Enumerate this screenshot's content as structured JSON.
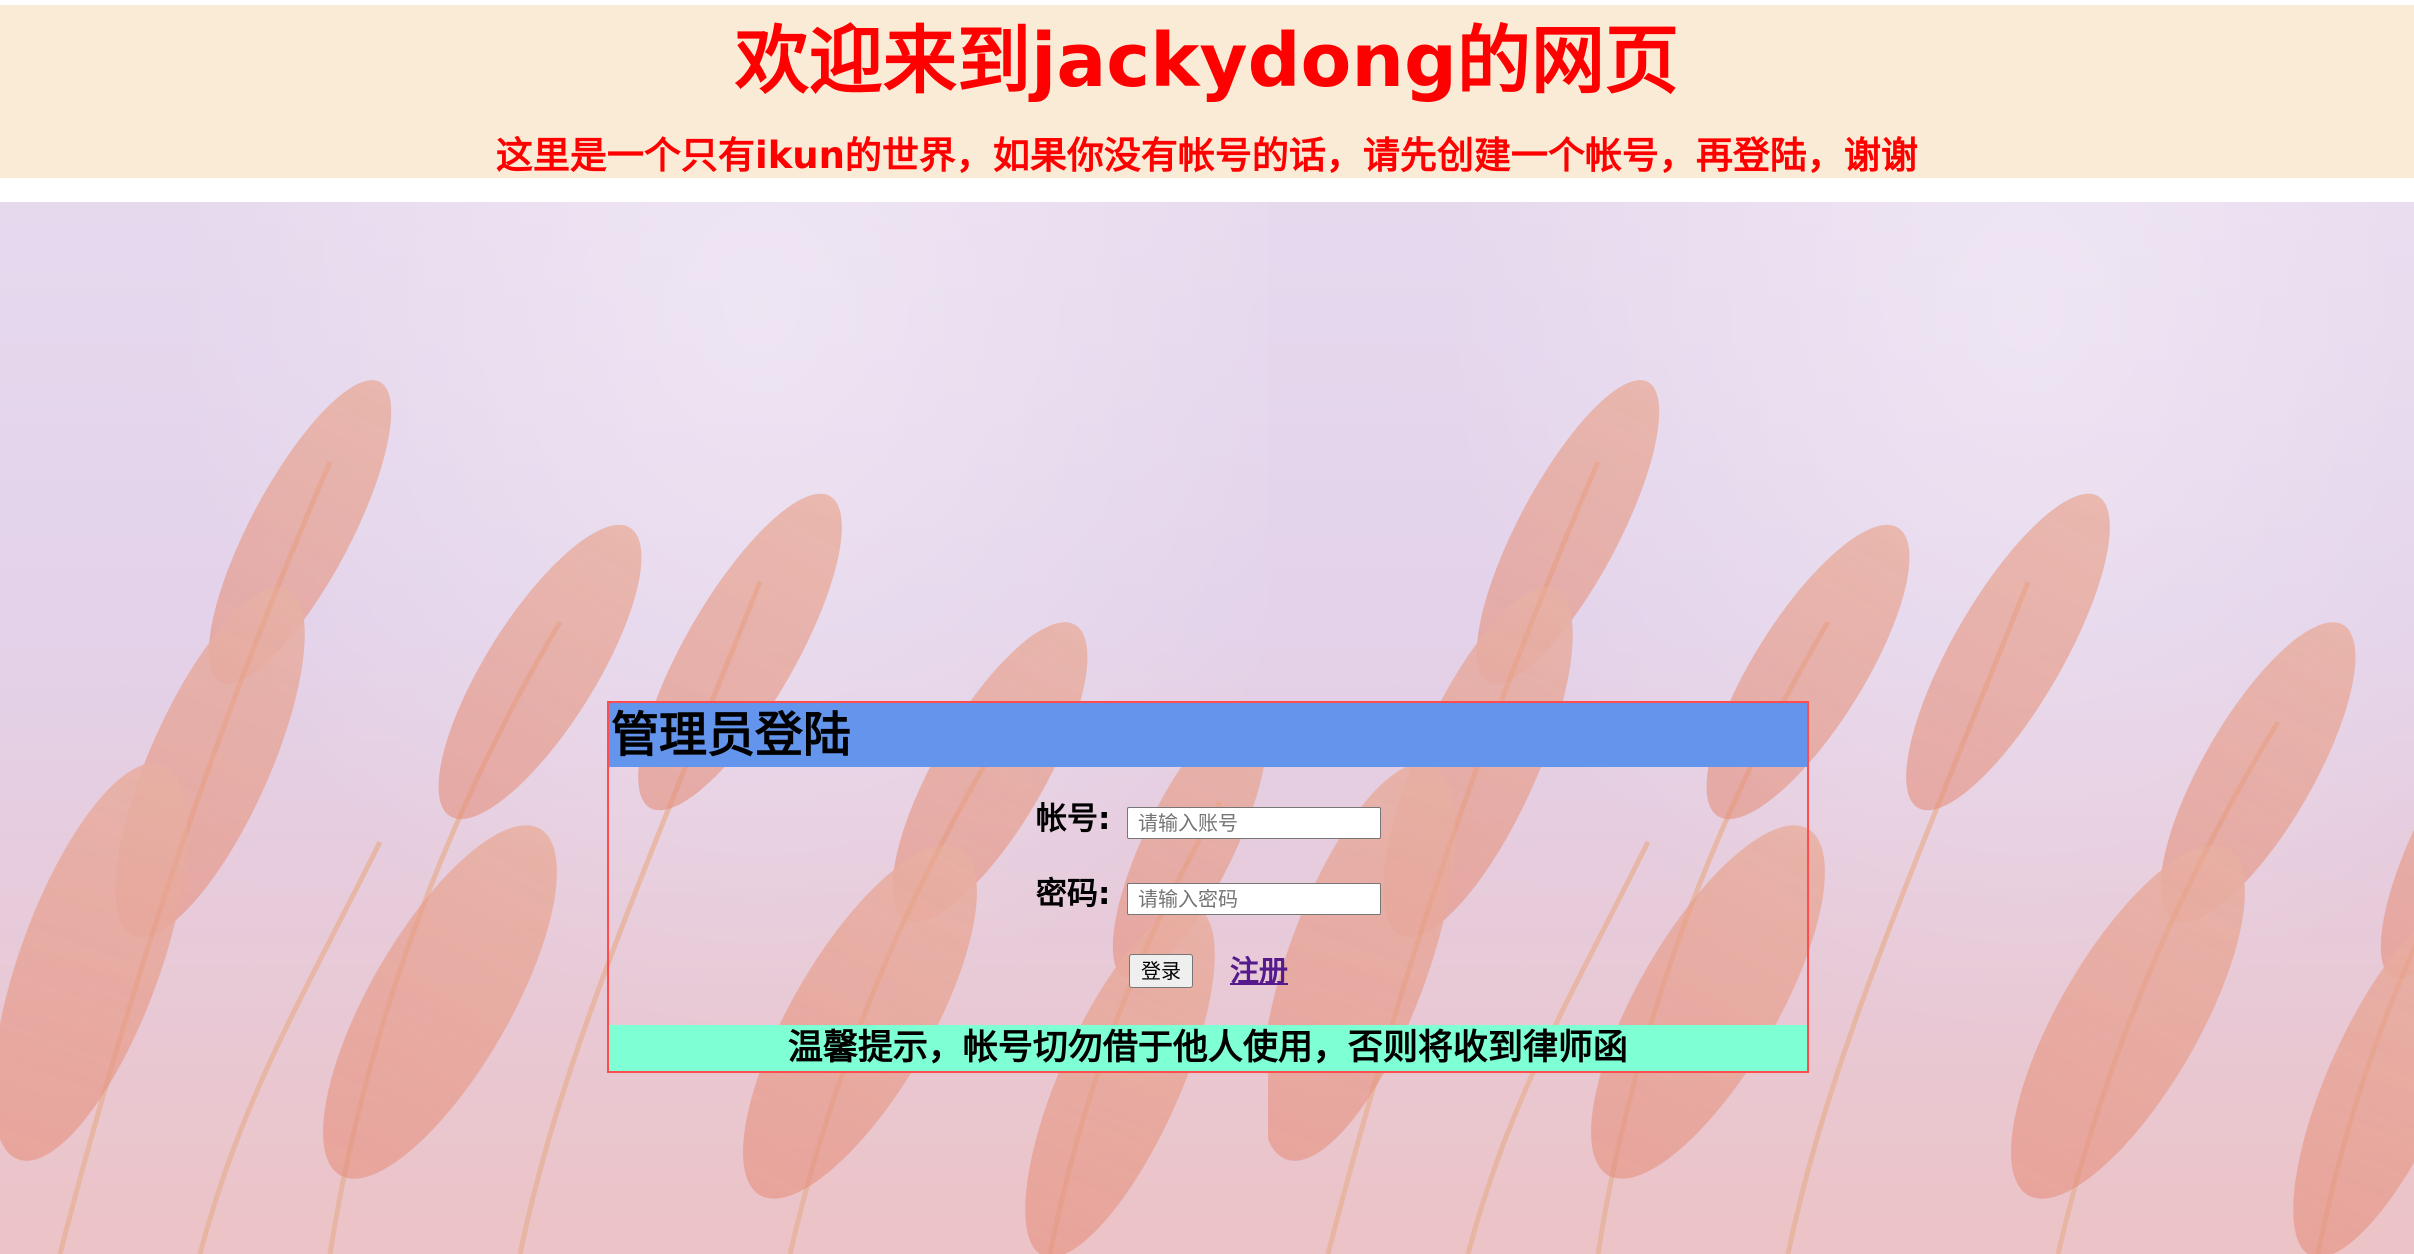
{
  "header": {
    "title": "欢迎来到jackydong的网页",
    "subtitle": "这里是一个只有ikun的世界，如果你没有帐号的话，请先创建一个帐号，再登陆，谢谢"
  },
  "login": {
    "title": "管理员登陆",
    "account_label": "帐号:",
    "account_placeholder": "请输入账号",
    "password_label": "密码:",
    "password_placeholder": "请输入密码",
    "login_button": "登录",
    "register_link": "注册",
    "tip": "温馨提示，帐号切勿借于他人使用，否则将收到律师函"
  },
  "colors": {
    "header_bg": "#faebd7",
    "header_text": "#ff0000",
    "login_title_bg": "#6495ed",
    "login_border": "#ff4d4d",
    "tip_bg": "#7fffd4",
    "link": "#551a8b"
  },
  "background": {
    "image": "pink pampas grass against lavender sky, tiled twice"
  }
}
